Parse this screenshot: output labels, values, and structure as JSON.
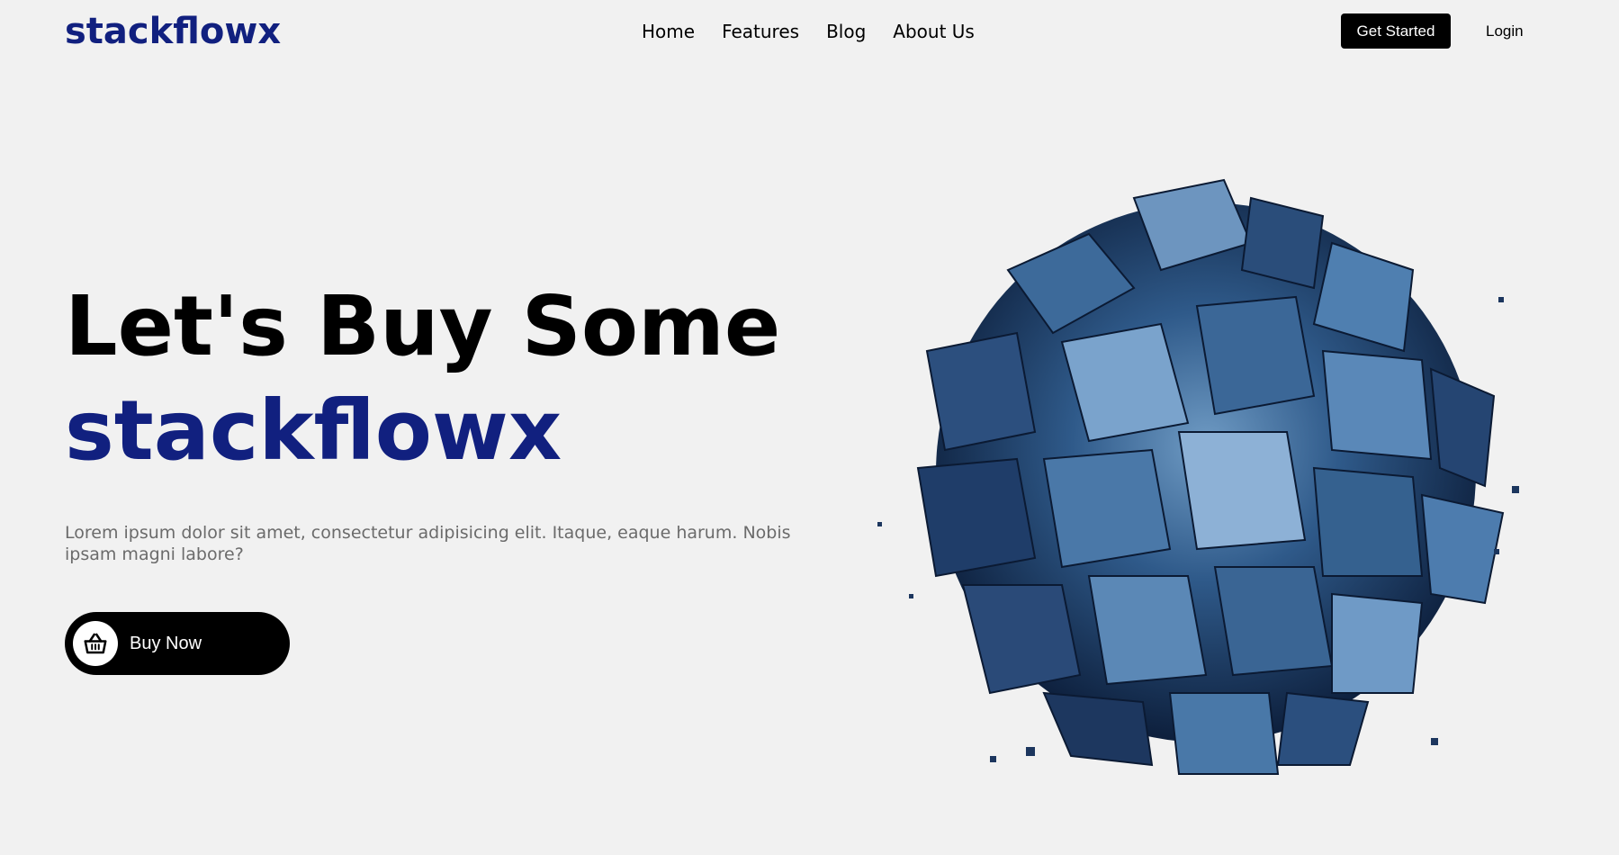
{
  "brand": {
    "logo_text": "stackflowx",
    "brand_color": "#11207f"
  },
  "nav": {
    "items": [
      {
        "label": "Home"
      },
      {
        "label": "Features"
      },
      {
        "label": "Blog"
      },
      {
        "label": "About Us"
      }
    ]
  },
  "header_actions": {
    "get_started_label": "Get Started",
    "login_label": "Login"
  },
  "hero": {
    "title_line1": "Let's Buy Some",
    "title_line2": "stackflowx",
    "description": "Lorem ipsum dolor sit amet, consectetur adipisicing elit. Itaque, eaque harum. Nobis ipsam magni labore?",
    "buy_label": "Buy Now",
    "buy_icon": "basket-icon",
    "art_icon": "abstract-cube-sphere-illustration"
  }
}
